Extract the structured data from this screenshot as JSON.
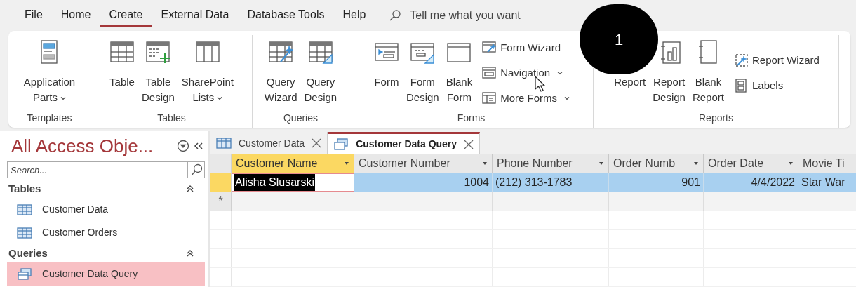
{
  "menu_tabs": [
    {
      "label": "File",
      "selected": false
    },
    {
      "label": "Home",
      "selected": false
    },
    {
      "label": "Create",
      "selected": true
    },
    {
      "label": "External Data",
      "selected": false
    },
    {
      "label": "Database Tools",
      "selected": false
    },
    {
      "label": "Help",
      "selected": false
    }
  ],
  "tell_me": {
    "placeholder": "Tell me what you want"
  },
  "ribbon": {
    "groups": [
      {
        "label": "Templates",
        "buttons": [
          {
            "kind": "large",
            "label": "Application\nParts",
            "dropdown": true
          }
        ]
      },
      {
        "label": "Tables",
        "buttons": [
          {
            "kind": "large",
            "label": "Table",
            "dropdown": false
          },
          {
            "kind": "large",
            "label": "Table\nDesign",
            "dropdown": false
          },
          {
            "kind": "large",
            "label": "SharePoint\nLists",
            "dropdown": true
          }
        ]
      },
      {
        "label": "Queries",
        "buttons": [
          {
            "kind": "large",
            "label": "Query\nWizard",
            "dropdown": false
          },
          {
            "kind": "large",
            "label": "Query\nDesign",
            "dropdown": false
          }
        ]
      },
      {
        "label": "Forms",
        "buttons": [
          {
            "kind": "large",
            "label": "Form",
            "dropdown": false
          },
          {
            "kind": "large",
            "label": "Form\nDesign",
            "dropdown": false
          },
          {
            "kind": "large",
            "label": "Blank\nForm",
            "dropdown": false
          },
          {
            "kind": "small",
            "label": "Form Wizard",
            "dropdown": false
          },
          {
            "kind": "small",
            "label": "Navigation",
            "dropdown": true
          },
          {
            "kind": "small",
            "label": "More Forms",
            "dropdown": true
          }
        ]
      },
      {
        "label": "Reports",
        "buttons": [
          {
            "kind": "large",
            "label": "Report",
            "dropdown": false
          },
          {
            "kind": "large",
            "label": "Report\nDesign",
            "dropdown": false
          },
          {
            "kind": "large",
            "label": "Blank\nReport",
            "dropdown": false
          },
          {
            "kind": "small",
            "label": "Report Wizard",
            "dropdown": false
          },
          {
            "kind": "small",
            "label": "Labels",
            "dropdown": false
          }
        ]
      }
    ]
  },
  "nav_pane": {
    "title": "All Access Obje...",
    "search": {
      "placeholder": "Search..."
    },
    "sections": [
      {
        "title": "Tables",
        "expanded": true,
        "items": [
          {
            "label": "Customer Data",
            "selected": false
          },
          {
            "label": "Customer Orders",
            "selected": false
          }
        ]
      },
      {
        "title": "Queries",
        "expanded": true,
        "items": [
          {
            "label": "Customer Data Query",
            "selected": true
          }
        ]
      }
    ]
  },
  "document_tabs": [
    {
      "label": "Customer Data",
      "selected": false
    },
    {
      "label": "Customer Data Query",
      "selected": true
    }
  ],
  "datasheet": {
    "columns": [
      {
        "label": "Customer Name",
        "kind": "text",
        "selected": true
      },
      {
        "label": "Customer Number",
        "kind": "number",
        "selected": false
      },
      {
        "label": "Phone Number",
        "kind": "text",
        "selected": false
      },
      {
        "label": "Order Numb",
        "kind": "number",
        "selected": false
      },
      {
        "label": "Order Date",
        "kind": "number",
        "selected": false
      },
      {
        "label": "Movie Ti",
        "kind": "text",
        "selected": false
      }
    ],
    "rows": [
      {
        "selected": true,
        "cells": [
          "Alisha Slusarski",
          "1004",
          "(212) 313-1783",
          "901",
          "4/4/2022",
          "Star War"
        ]
      }
    ],
    "new_row_marker": "*"
  },
  "annotation": {
    "label": "1"
  }
}
